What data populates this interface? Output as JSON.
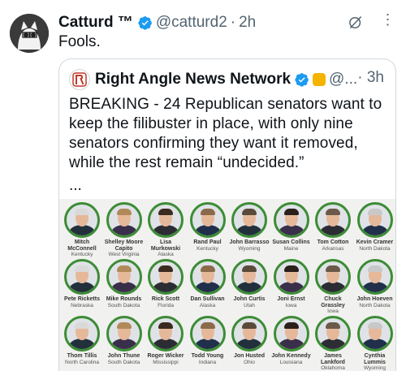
{
  "tweet": {
    "author_name": "Catturd ™",
    "handle": "@catturd2",
    "time": "2h",
    "text": "Fools."
  },
  "quote": {
    "author_name": "Right Angle News Network",
    "handle": "@...",
    "time": "3h",
    "text": "BREAKING - 24 Republican senators want to keep the filibuster in place, with only nine senators confirming they want it removed, while the rest remain “undecided.”",
    "ellipsis": "..."
  },
  "senators": [
    {
      "name": "Mitch McConnell",
      "state": "Kentucky"
    },
    {
      "name": "Shelley Moore Capito",
      "state": "West Virginia"
    },
    {
      "name": "Lisa Murkowski",
      "state": "Alaska"
    },
    {
      "name": "Rand Paul",
      "state": "Kentucky"
    },
    {
      "name": "John Barrasso",
      "state": "Wyoming"
    },
    {
      "name": "Susan Collins",
      "state": "Maine"
    },
    {
      "name": "Tom Cotton",
      "state": "Arkansas"
    },
    {
      "name": "Kevin Cramer",
      "state": "North Dakota"
    },
    {
      "name": "Pete Ricketts",
      "state": "Nebraska"
    },
    {
      "name": "Mike Rounds",
      "state": "South Dakota"
    },
    {
      "name": "Rick Scott",
      "state": "Florida"
    },
    {
      "name": "Dan Sullivan",
      "state": "Alaska"
    },
    {
      "name": "John Curtis",
      "state": "Utah"
    },
    {
      "name": "Joni Ernst",
      "state": "Iowa"
    },
    {
      "name": "Chuck Grassley",
      "state": "Iowa"
    },
    {
      "name": "John Hoeven",
      "state": "North Dakota"
    },
    {
      "name": "Thom Tillis",
      "state": "North Carolina"
    },
    {
      "name": "John Thune",
      "state": "South Dakota"
    },
    {
      "name": "Roger Wicker",
      "state": "Mississippi"
    },
    {
      "name": "Todd Young",
      "state": "Indiana"
    },
    {
      "name": "Jon Husted",
      "state": "Ohio"
    },
    {
      "name": "John Kennedy",
      "state": "Louisiana"
    },
    {
      "name": "James Lankford",
      "state": "Oklahoma"
    },
    {
      "name": "Cynthia Lummis",
      "state": "Wyoming"
    }
  ],
  "colors": {
    "verified": "#1d9bf0",
    "ring": "#3c8c35",
    "secondary_text": "#536471"
  }
}
